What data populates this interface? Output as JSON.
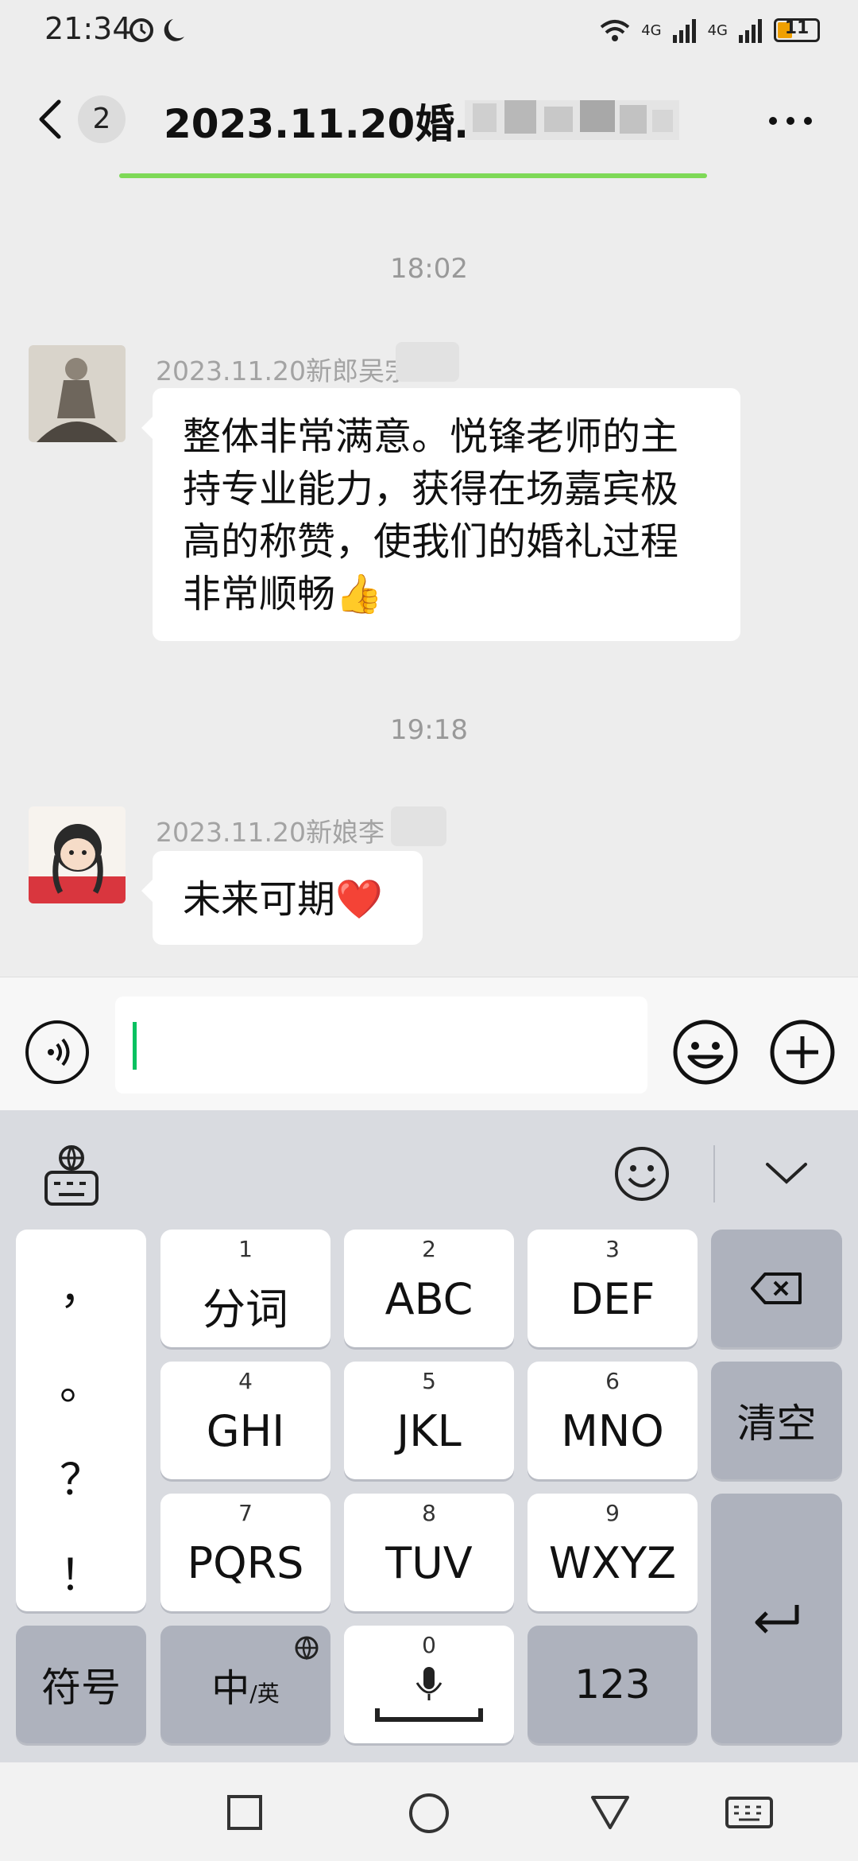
{
  "status_bar": {
    "time": "21:34",
    "network_labels": [
      "4G",
      "4G"
    ],
    "battery": "11"
  },
  "header": {
    "unread_count": "2",
    "title": "2023.11.20婚…"
  },
  "messages": [
    {
      "time": "18:02",
      "sender": "2023.11.20新郎吴宗",
      "text_lines": [
        "整体非常满意。悦锋老师的主",
        "持专业能力，获得在场嘉宾极",
        "高的称赞，使我们的婚礼过程",
        "非常顺畅👍"
      ]
    },
    {
      "time": "19:18",
      "sender": "2023.11.20新娘李",
      "text_lines": [
        "未来可期❤️"
      ]
    }
  ],
  "input": {
    "value": ""
  },
  "keyboard": {
    "punctuation": [
      "，",
      "。",
      "？",
      "！"
    ],
    "keys": [
      {
        "num": "1",
        "label": "分词"
      },
      {
        "num": "2",
        "label": "ABC"
      },
      {
        "num": "3",
        "label": "DEF"
      },
      {
        "num": "4",
        "label": "GHI"
      },
      {
        "num": "5",
        "label": "JKL"
      },
      {
        "num": "6",
        "label": "MNO"
      },
      {
        "num": "7",
        "label": "PQRS"
      },
      {
        "num": "8",
        "label": "TUV"
      },
      {
        "num": "9",
        "label": "WXYZ"
      }
    ],
    "clear_label": "清空",
    "symbol_label": "符号",
    "lang_main": "中",
    "lang_sub": "/英",
    "space_num": "0",
    "num_label": "123"
  },
  "colors": {
    "accent_green": "#07c160",
    "progress_green": "#7ed957",
    "chat_bg": "#ededed"
  },
  "icons": [
    "back-chevron-icon",
    "more-dots-icon",
    "voice-icon",
    "emoji-icon",
    "plus-icon",
    "globe-keyboard-icon",
    "smiley-icon",
    "chevron-down-icon",
    "backspace-icon",
    "enter-icon",
    "mic-icon",
    "globe-icon",
    "square-icon",
    "circle-icon",
    "triangle-icon",
    "keyboard-icon"
  ]
}
